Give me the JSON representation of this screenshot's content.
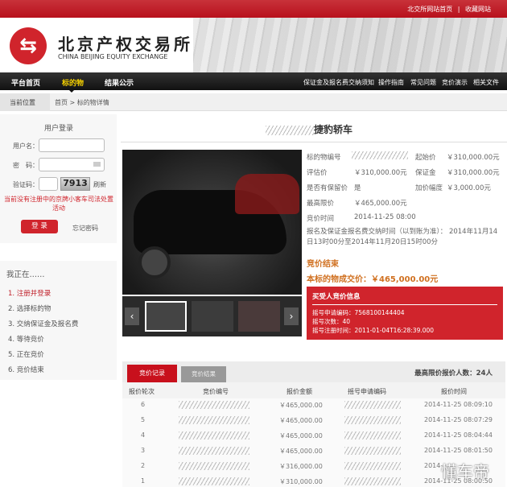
{
  "topbar": {
    "links": [
      "北交所网站首页",
      "|",
      "收藏网站"
    ]
  },
  "header": {
    "logo_cn": "北京产权交易所",
    "logo_en": "CHINA BEIJING EQUITY EXCHANGE"
  },
  "nav": {
    "left": [
      "平台首页",
      "标的物",
      "结果公示"
    ],
    "right": [
      "保证金及报名费交纳须知",
      "操作指南",
      "常见问题",
      "竞价演示",
      "相关文件"
    ]
  },
  "breadcrumb": {
    "label": "当前位置",
    "path": "首页 > 标的物详情"
  },
  "login": {
    "title": "用户登录",
    "username_label": "用户名：",
    "password_label": "密　码：",
    "captcha_label": "验证码：",
    "captcha": "7913",
    "refresh": "刷新",
    "notice": "当前没有注册中的京牌小客车司法处置活动",
    "login_btn": "登 录",
    "forgot": "忘记密码"
  },
  "steps": {
    "title": "我正在……",
    "items": [
      "1. 注册并登录",
      "2. 选择标的物",
      "3. 交纳保证金及报名费",
      "4. 等待竞价",
      "5. 正在竞价",
      "6. 竞价结束"
    ]
  },
  "item": {
    "title": "捷豹轿车",
    "labels": {
      "code": "标的物编号",
      "start": "起始价",
      "eval": "评估价",
      "deposit": "保证金",
      "reserve": "是否有保留价",
      "increment": "加价幅度",
      "max": "最高限价",
      "time": "竞价时间"
    },
    "values": {
      "start": "￥310,000.00元",
      "eval": "￥310,000.00元",
      "deposit": "￥310,000.00元",
      "reserve": "是",
      "increment": "￥3,000.00元",
      "max": "￥465,000.00元",
      "time": "2014-11-25 08:00"
    },
    "signup": "报名及保证金报名费交纳时间（以到账为准）： 2014年11月14日13时00分至2014年11月20日15时00分",
    "status": "竞价结束",
    "final": "本标的物成交价：￥465,000.00元"
  },
  "winner": {
    "title": "买受人竞价信息",
    "lines": [
      "摇号申请编码：7568100144404",
      "摇号次数：40",
      "摇号注册时间：2011-01-04T16:28:39.000"
    ]
  },
  "records": {
    "tabs": [
      "竞价记录",
      "竞价结果"
    ],
    "summary": "最高限价报价人数：24人",
    "headers": [
      "报价轮次",
      "竞价编号",
      "报价金额",
      "摇号申请编码",
      "报价时间"
    ],
    "rows": [
      [
        "6",
        "￥465,000.00",
        "2014-11-25 08:09:10"
      ],
      [
        "5",
        "￥465,000.00",
        "2014-11-25 08:07:29"
      ],
      [
        "4",
        "￥465,000.00",
        "2014-11-25 08:04:44"
      ],
      [
        "3",
        "￥465,000.00",
        "2014-11-25 08:01:50"
      ],
      [
        "2",
        "￥316,000.00",
        "2014-"
      ],
      [
        "1",
        "￥310,000.00",
        "2014-11-25 08:00:50"
      ]
    ]
  },
  "watermark": "懂车帝"
}
